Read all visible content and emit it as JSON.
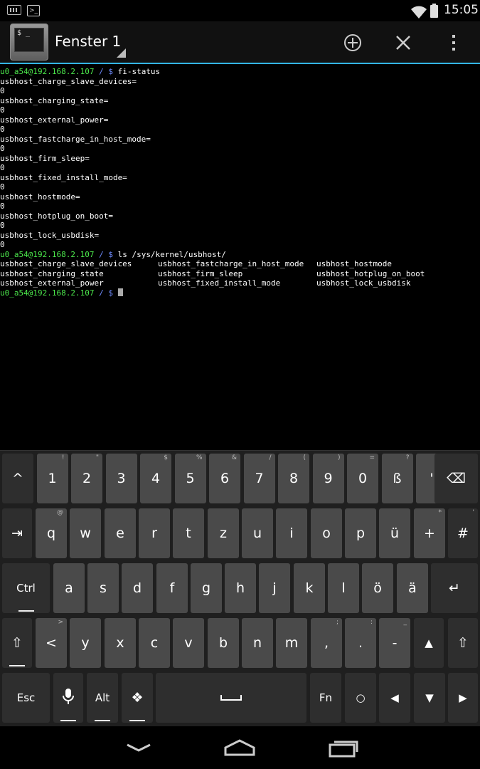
{
  "status_bar": {
    "time": "15:05",
    "icons": [
      "keyboard-icon",
      "terminal-icon",
      "wifi-icon",
      "battery-icon"
    ]
  },
  "action_bar": {
    "title": "Fenster 1",
    "app_icon_text": "$ _",
    "buttons": [
      "add-window",
      "close-window",
      "overflow-menu"
    ]
  },
  "terminal": {
    "prompt": "u0_a54@192.168.2.107 / $",
    "command1": "fi-status",
    "output1": [
      "usbhost_charge_slave_devices=",
      "0",
      "usbhost_charging_state=",
      "0",
      "usbhost_external_power=",
      "0",
      "usbhost_fastcharge_in_host_mode=",
      "0",
      "usbhost_firm_sleep=",
      "0",
      "usbhost_fixed_install_mode=",
      "0",
      "usbhost_hostmode=",
      "0",
      "usbhost_hotplug_on_boot=",
      "0",
      "usbhost_lock_usbdisk=",
      "0"
    ],
    "command2": "ls /sys/kernel/usbhost/",
    "ls_rows": [
      [
        "usbhost_charge_slave_devices",
        "usbhost_fastcharge_in_host_mode",
        "usbhost_hostmode"
      ],
      [
        "usbhost_charging_state",
        "usbhost_firm_sleep",
        "usbhost_hotplug_on_boot"
      ],
      [
        "usbhost_external_power",
        "usbhost_fixed_install_mode",
        "usbhost_lock_usbdisk"
      ]
    ]
  },
  "keyboard": {
    "row1": [
      {
        "label": "^",
        "sub": ""
      },
      {
        "label": "1",
        "sub": "!"
      },
      {
        "label": "2",
        "sub": "\""
      },
      {
        "label": "3",
        "sub": ""
      },
      {
        "label": "4",
        "sub": "$"
      },
      {
        "label": "5",
        "sub": "%"
      },
      {
        "label": "6",
        "sub": "&"
      },
      {
        "label": "7",
        "sub": "/"
      },
      {
        "label": "8",
        "sub": "("
      },
      {
        "label": "9",
        "sub": ")"
      },
      {
        "label": "0",
        "sub": "="
      },
      {
        "label": "ß",
        "sub": "?"
      },
      {
        "label": "'",
        "sub": ""
      },
      {
        "label": "⌫",
        "sub": ""
      }
    ],
    "row2": [
      {
        "label": "⇥",
        "sub": ""
      },
      {
        "label": "q",
        "sub": "@"
      },
      {
        "label": "w",
        "sub": ""
      },
      {
        "label": "e",
        "sub": ""
      },
      {
        "label": "r",
        "sub": ""
      },
      {
        "label": "t",
        "sub": ""
      },
      {
        "label": "z",
        "sub": ""
      },
      {
        "label": "u",
        "sub": ""
      },
      {
        "label": "i",
        "sub": ""
      },
      {
        "label": "o",
        "sub": ""
      },
      {
        "label": "p",
        "sub": ""
      },
      {
        "label": "ü",
        "sub": ""
      },
      {
        "label": "+",
        "sub": "*"
      },
      {
        "label": "#",
        "sub": "'"
      }
    ],
    "row3": [
      {
        "label": "Ctrl",
        "sub": ""
      },
      {
        "label": "a",
        "sub": ""
      },
      {
        "label": "s",
        "sub": ""
      },
      {
        "label": "d",
        "sub": ""
      },
      {
        "label": "f",
        "sub": ""
      },
      {
        "label": "g",
        "sub": ""
      },
      {
        "label": "h",
        "sub": ""
      },
      {
        "label": "j",
        "sub": ""
      },
      {
        "label": "k",
        "sub": ""
      },
      {
        "label": "l",
        "sub": ""
      },
      {
        "label": "ö",
        "sub": ""
      },
      {
        "label": "ä",
        "sub": ""
      },
      {
        "label": "↵",
        "sub": ""
      }
    ],
    "row4": [
      {
        "label": "⇧",
        "sub": ""
      },
      {
        "label": "<",
        "sub": ">"
      },
      {
        "label": "y",
        "sub": ""
      },
      {
        "label": "x",
        "sub": ""
      },
      {
        "label": "c",
        "sub": ""
      },
      {
        "label": "v",
        "sub": ""
      },
      {
        "label": "b",
        "sub": ""
      },
      {
        "label": "n",
        "sub": ""
      },
      {
        "label": "m",
        "sub": ""
      },
      {
        "label": ",",
        "sub": ";"
      },
      {
        "label": ".",
        "sub": ":"
      },
      {
        "label": "-",
        "sub": "_"
      },
      {
        "label": "▲",
        "sub": ""
      },
      {
        "label": "⇧",
        "sub": ""
      }
    ],
    "row5": [
      {
        "label": "Esc",
        "sub": ""
      },
      {
        "label": "mic",
        "sub": ""
      },
      {
        "label": "Alt",
        "sub": ""
      },
      {
        "label": "❖",
        "sub": ""
      },
      {
        "label": "␣",
        "sub": ""
      },
      {
        "label": "Fn",
        "sub": ""
      },
      {
        "label": "○",
        "sub": ""
      },
      {
        "label": "◀",
        "sub": ""
      },
      {
        "label": "▼",
        "sub": ""
      },
      {
        "label": "▶",
        "sub": ""
      }
    ]
  },
  "nav_bar": [
    "back",
    "home",
    "recents"
  ]
}
